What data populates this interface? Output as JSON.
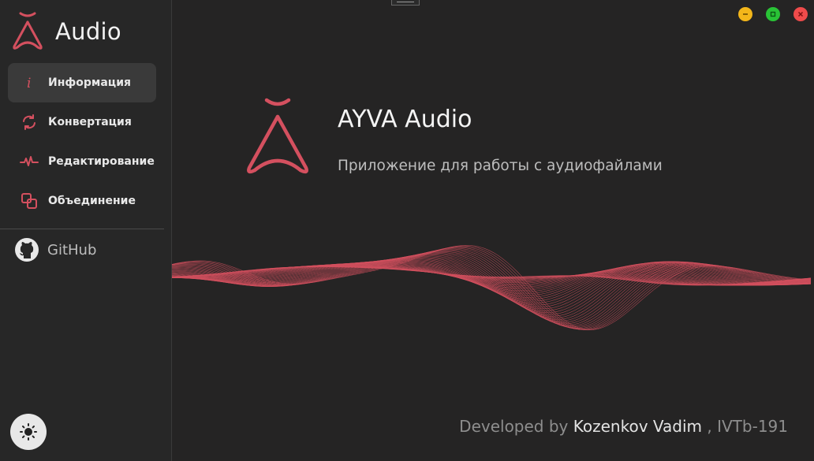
{
  "app": {
    "title": "Audio"
  },
  "sidebar": {
    "items": [
      {
        "label": "Информация",
        "icon": "info-icon",
        "active": true
      },
      {
        "label": "Конвертация",
        "icon": "convert-icon",
        "active": false
      },
      {
        "label": "Редактирование",
        "icon": "waveform-icon",
        "active": false
      },
      {
        "label": "Объединение",
        "icon": "merge-icon",
        "active": false
      }
    ],
    "github_label": "GitHub"
  },
  "main": {
    "title": "AYVA Audio",
    "subtitle": "Приложение для работы с аудиофайлами",
    "footer": {
      "prefix": "Developed by",
      "author": "Kozenkov Vadim",
      "suffix": ", IVTb-191"
    }
  },
  "colors": {
    "accent": "#d4505f",
    "background": "#252424",
    "sidebar": "#272727",
    "active_item": "#3a3a3a",
    "minimize": "#f3b61a",
    "maximize": "#29c336",
    "close": "#ef4b4b"
  },
  "icons": {
    "theme_toggle": "sun-icon",
    "github": "github-icon",
    "window_controls": [
      "minimize-icon",
      "maximize-icon",
      "close-icon"
    ]
  }
}
